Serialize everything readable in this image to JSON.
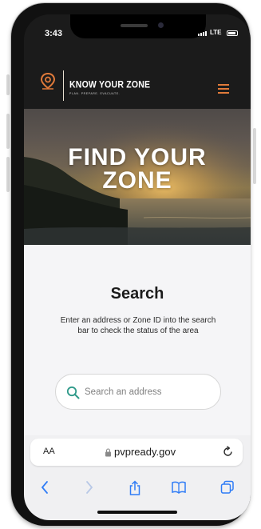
{
  "status_bar": {
    "time": "3:43",
    "carrier": "LTE"
  },
  "header": {
    "title": "KNOW YOUR ZONE",
    "tagline": "PLAN. PREPARE. EVACUATE.",
    "accent_color": "#e07a3a"
  },
  "hero": {
    "title_line1": "FIND YOUR",
    "title_line2": "ZONE"
  },
  "search": {
    "heading": "Search",
    "description": "Enter an address or Zone ID into the search bar to check the status of the area",
    "placeholder": "Search an address",
    "icon_color": "#2f9a8a"
  },
  "browser": {
    "text_size_label": "AA",
    "url": "pvpready.gov",
    "toolbar_icons": [
      "back-icon",
      "forward-icon",
      "share-icon",
      "bookmarks-icon",
      "tabs-icon"
    ],
    "accent_color": "#2f7cf6"
  }
}
